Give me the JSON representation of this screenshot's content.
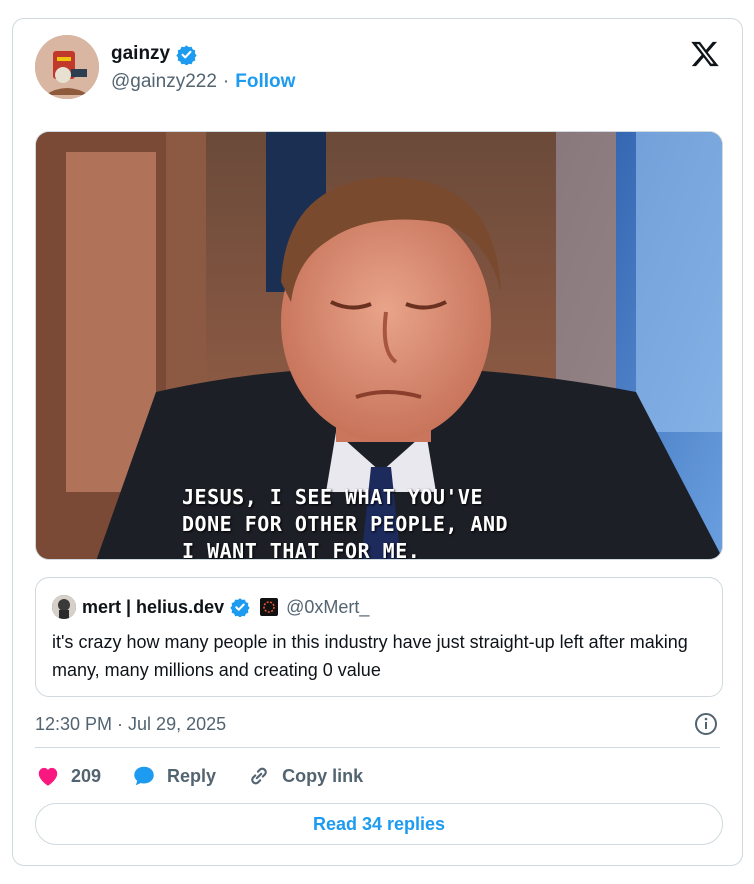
{
  "tweet": {
    "author": {
      "display_name": "gainzy",
      "handle": "@gainzy222",
      "separator": "·",
      "follow_label": "Follow",
      "verified": true
    },
    "media": {
      "caption_lines": [
        "JESUS, I SEE WHAT YOU'VE",
        "DONE FOR OTHER PEOPLE, AND",
        "I WANT THAT FOR ME."
      ]
    },
    "quoted": {
      "display_name": "mert | helius.dev",
      "handle": "@0xMert_",
      "text": "it's crazy how many people in this industry have just straight-up left after making many, many millions and creating 0 value"
    },
    "timestamp": "12:30 PM · Jul 29, 2025",
    "actions": {
      "likes_count": "209",
      "reply_label": "Reply",
      "copy_link_label": "Copy link"
    },
    "read_replies_label": "Read 34 replies"
  },
  "colors": {
    "accent": "#1d9bf0",
    "like": "#f91880",
    "muted": "#536471",
    "border": "#cfd9de"
  },
  "icons": [
    "verified-badge-icon",
    "x-logo-icon",
    "info-icon",
    "heart-icon",
    "reply-icon",
    "link-icon"
  ]
}
